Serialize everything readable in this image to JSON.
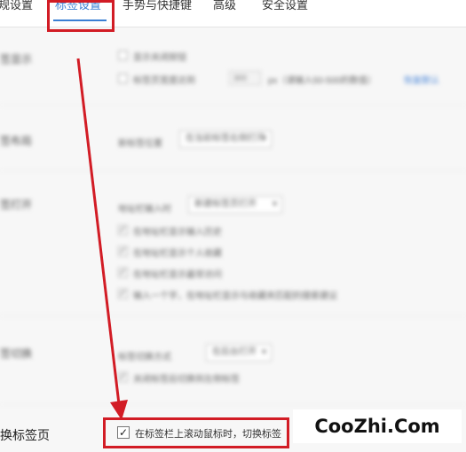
{
  "tabs": [
    {
      "label": "规设置"
    },
    {
      "label": "标签设置"
    },
    {
      "label": "手势与快捷键"
    },
    {
      "label": "高级"
    },
    {
      "label": "安全设置"
    }
  ],
  "active_tab_index": 1,
  "sections": [
    {
      "label": "签显示"
    },
    {
      "label": "签布局"
    },
    {
      "label": "签打开"
    },
    {
      "label": "签切换"
    }
  ],
  "section_0": {
    "option_1": "显示关闭按钮",
    "option_2": "标签页宽度达到",
    "width_value": "300",
    "unit_hint": "px（请输入50-500的数值）",
    "link": "恢复默认"
  },
  "section_1": {
    "label": "新标签位置",
    "select": "在当前标签右侧打开"
  },
  "section_2": {
    "label": "地址栏输入时",
    "select": "新建标签页打开",
    "checks": [
      "在地址栏显示输入历史",
      "在地址栏显示个人收藏",
      "在地址栏显示最常访问",
      "输入一个字，在地址栏显示与收藏夹匹配的搜索建议"
    ]
  },
  "section_3": {
    "label": "标签切换方式",
    "select": "在后台打开",
    "check": "关闭标签后切换到左侧标签"
  },
  "final_row": {
    "label": "换标签页",
    "option": "在标签栏上滚动鼠标时，切换标签",
    "checked": true
  },
  "watermark": "CooZhi.Com",
  "colors": {
    "accent": "#3a7fd4",
    "highlight": "#d21c25"
  }
}
